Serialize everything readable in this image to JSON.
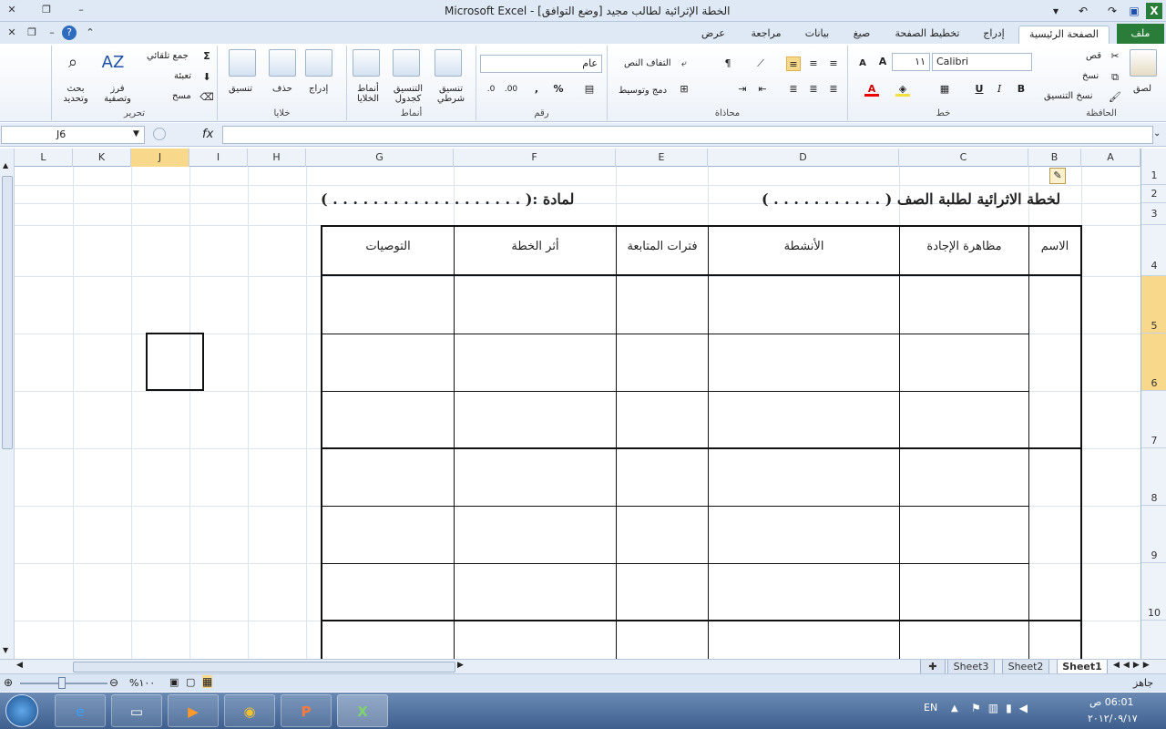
{
  "window": {
    "title": "الخطة الإثرائية لطالب مجيد  [وضع التوافق] - Microsoft Excel",
    "file_tab": "ملف",
    "tabs": [
      "الصفحة الرئيسية",
      "إدراج",
      "تخطيط الصفحة",
      "صيغ",
      "بيانات",
      "مراجعة",
      "عرض"
    ]
  },
  "ribbon": {
    "clipboard": {
      "label": "الحافظة",
      "paste": "لصق",
      "cut": "قص",
      "copy": "نسخ",
      "format_painter": "نسخ التنسيق"
    },
    "font": {
      "label": "خط",
      "name": "Calibri",
      "size": "١١"
    },
    "alignment": {
      "label": "محاذاة",
      "wrap": "التفاف النص",
      "merge": "دمج وتوسيط"
    },
    "number": {
      "label": "رقم",
      "format": "عام"
    },
    "styles": {
      "label": "أنماط",
      "conditional": "تنسيق شرطي",
      "table": "التنسيق كجدول",
      "cell": "أنماط الخلايا"
    },
    "cells": {
      "label": "خلايا",
      "insert": "إدراج",
      "delete": "حذف",
      "format": "تنسيق"
    },
    "editing": {
      "label": "تحرير",
      "autosum": "جمع تلقائي",
      "fill": "تعبئة",
      "clear": "مسح",
      "sort": "فرز وتصفية",
      "find": "بحث وتحديد"
    }
  },
  "formula_bar": {
    "name_box": "J6",
    "fx": "fx",
    "content": ""
  },
  "columns": [
    "A",
    "B",
    "C",
    "D",
    "E",
    "F",
    "G",
    "H",
    "I",
    "J",
    "K",
    "L"
  ],
  "rows": [
    "1",
    "2",
    "3",
    "4",
    "5",
    "6",
    "7",
    "8",
    "9",
    "10"
  ],
  "sheet_content": {
    "title": "لخطة الاثرائية لطلبة الصف  ( . . . . . . . . . . . )",
    "subject": "لمادة :( . . . . . . . . . . . . . . . . . . . )",
    "headers": [
      "الاسم",
      "مظاهرة الإجادة",
      "الأنشطة",
      "فترات المتابعة",
      "أثر الخطة",
      "التوصيات"
    ]
  },
  "sheet_tabs": [
    "Sheet1",
    "Sheet2",
    "Sheet3"
  ],
  "status": {
    "ready": "جاهز",
    "zoom": "%١٠٠"
  },
  "taskbar": {
    "lang": "EN",
    "time": "06:01 ص",
    "date": "٢٠١٢/٠٩/١٧"
  }
}
